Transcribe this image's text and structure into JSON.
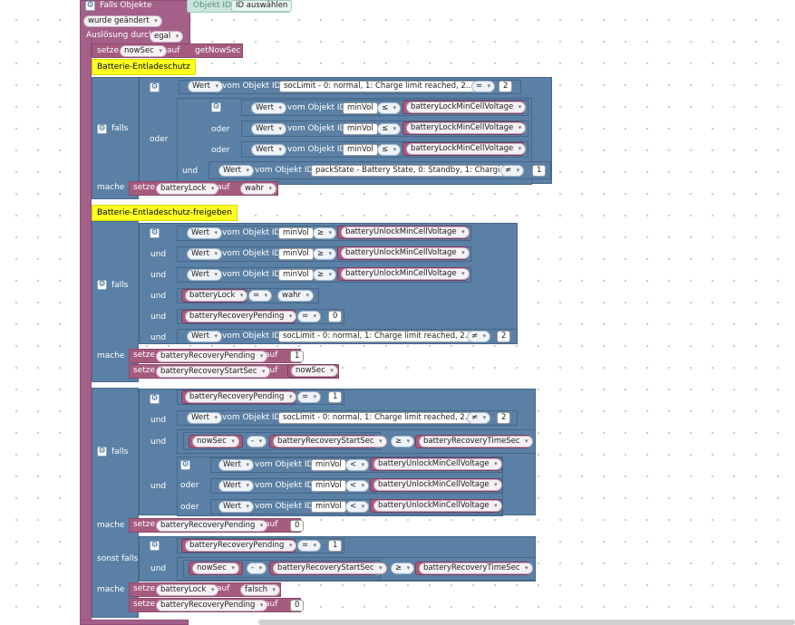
{
  "event": {
    "title": "Falls Objekte",
    "object_id_label": "Objekt ID",
    "object_id_value": "ID auswählen",
    "condition": "wurde geändert",
    "trigger_label": "Auslösung durch",
    "trigger_value": "egal"
  },
  "setnow": {
    "setze": "setze",
    "var": "nowSec",
    "auf": "auf",
    "value": "getNowSec"
  },
  "notes": [
    "Batterie-Entladeschutz",
    "Batterie-Entladeschutz-freigeben"
  ],
  "words": {
    "falls": "falls",
    "oder": "oder",
    "und": "und",
    "mache": "mache",
    "setze": "setze",
    "auf": "auf",
    "sonst_falls": "sonst falls",
    "wert": "Wert",
    "vom_objekt": "vom Objekt ID"
  },
  "ops": {
    "eq": "=",
    "le": "≤",
    "ge": "≥",
    "ne": "≠",
    "lt": "<",
    "minus": "-"
  },
  "objs": {
    "soc": "socLimit - 0: normal, 1: Charge limit reached, 2...",
    "minvol": "minVol",
    "pack": "packState - Battery State, 0: Standby, 1: Chargi..."
  },
  "vars": {
    "lockMin": "batteryLockMinCellVoltage",
    "unlockMin": "batteryUnlockMinCellVoltage",
    "lock": "batteryLock",
    "pending": "batteryRecoveryPending",
    "start": "batteryRecoveryStartSec",
    "time": "batteryRecoveryTimeSec",
    "now": "nowSec"
  },
  "values": {
    "two": "2",
    "one": "1",
    "zero": "0",
    "true": "wahr",
    "false": "falsch"
  }
}
